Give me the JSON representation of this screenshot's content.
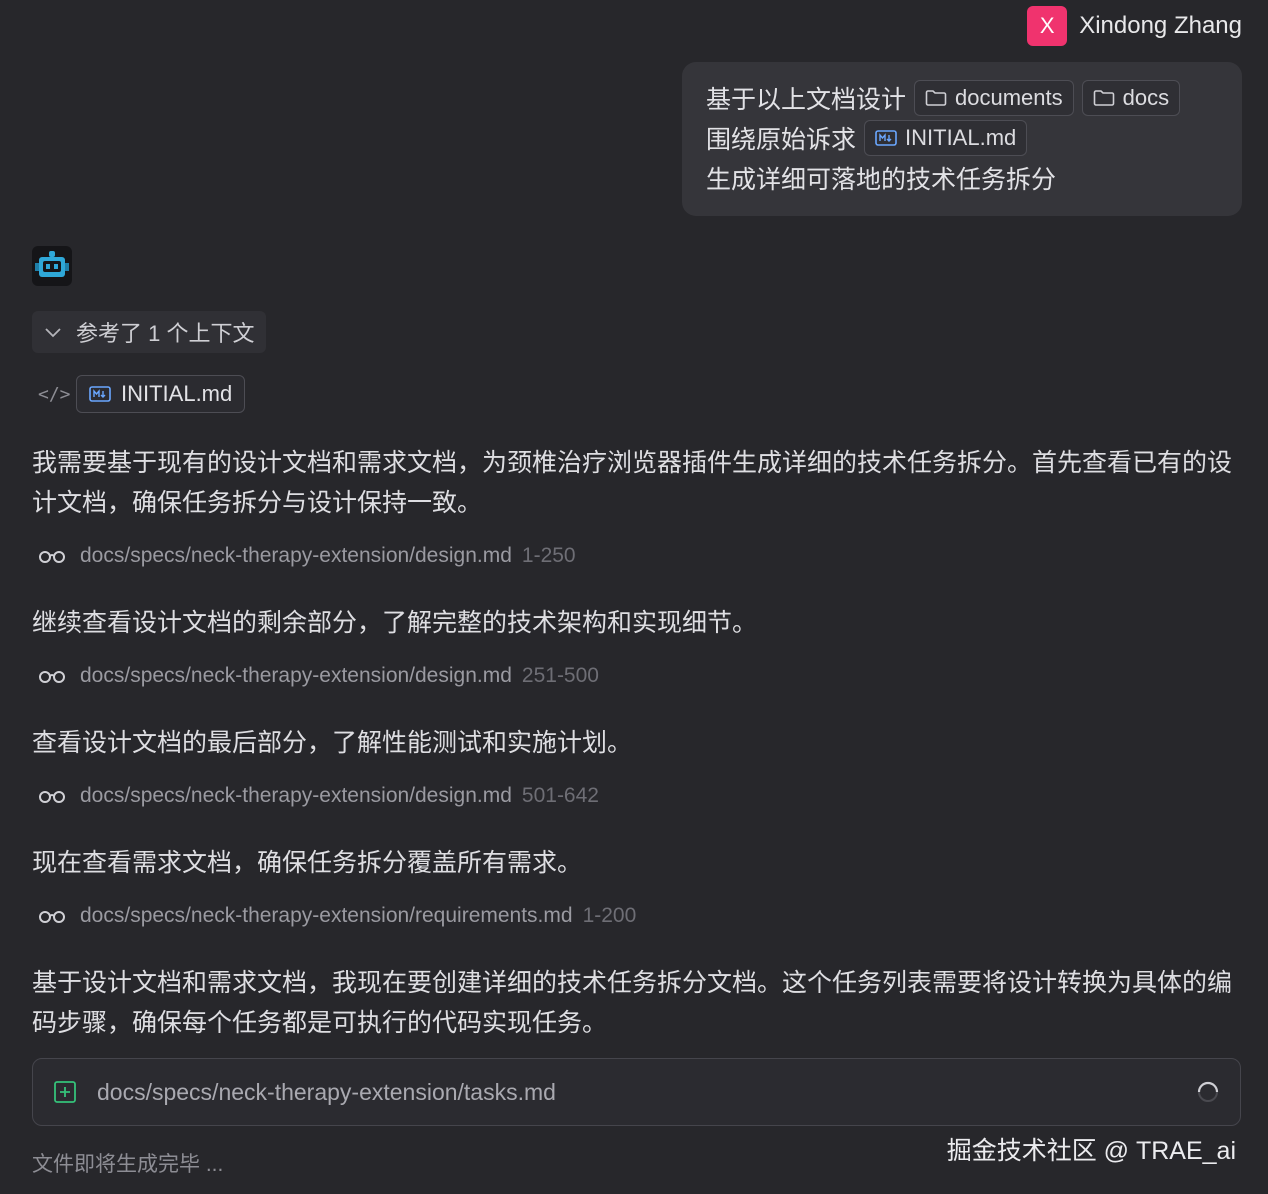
{
  "user": {
    "avatar_letter": "X",
    "avatar_color": "#f0336e",
    "name": "Xindong Zhang"
  },
  "user_message": {
    "line1_text": "基于以上文档设计",
    "chip_documents": "documents",
    "chip_docs": "docs",
    "line2_text": "围绕原始诉求",
    "chip_initial": "INITIAL.md",
    "line3_text": "生成详细可落地的技术任务拆分"
  },
  "assistant": {
    "avatar_icon": "robot-icon",
    "context_toggle": "参考了 1 个上下文",
    "context_file": "INITIAL.md",
    "paragraphs": [
      "我需要基于现有的设计文档和需求文档，为颈椎治疗浏览器插件生成详细的技术任务拆分。首先查看已有的设计文档，确保任务拆分与设计保持一致。",
      "继续查看设计文档的剩余部分，了解完整的技术架构和实现细节。",
      "查看设计文档的最后部分，了解性能测试和实施计划。",
      "现在查看需求文档，确保任务拆分覆盖所有需求。",
      "基于设计文档和需求文档，我现在要创建详细的技术任务拆分文档。这个任务列表需要将设计转换为具体的编码步骤，确保每个任务都是可执行的代码实现任务。"
    ],
    "file_reads": [
      {
        "path": "docs/specs/neck-therapy-extension/design.md",
        "range": "1-250"
      },
      {
        "path": "docs/specs/neck-therapy-extension/design.md",
        "range": "251-500"
      },
      {
        "path": "docs/specs/neck-therapy-extension/design.md",
        "range": "501-642"
      },
      {
        "path": "docs/specs/neck-therapy-extension/requirements.md",
        "range": "1-200"
      }
    ],
    "create_file": {
      "path": "docs/specs/neck-therapy-extension/tasks.md",
      "icon": "file-add-icon",
      "status_icon": "loading-spinner-icon"
    },
    "status_text": "文件即将生成完毕 ..."
  },
  "watermark": "掘金技术社区 @ TRAE_ai"
}
